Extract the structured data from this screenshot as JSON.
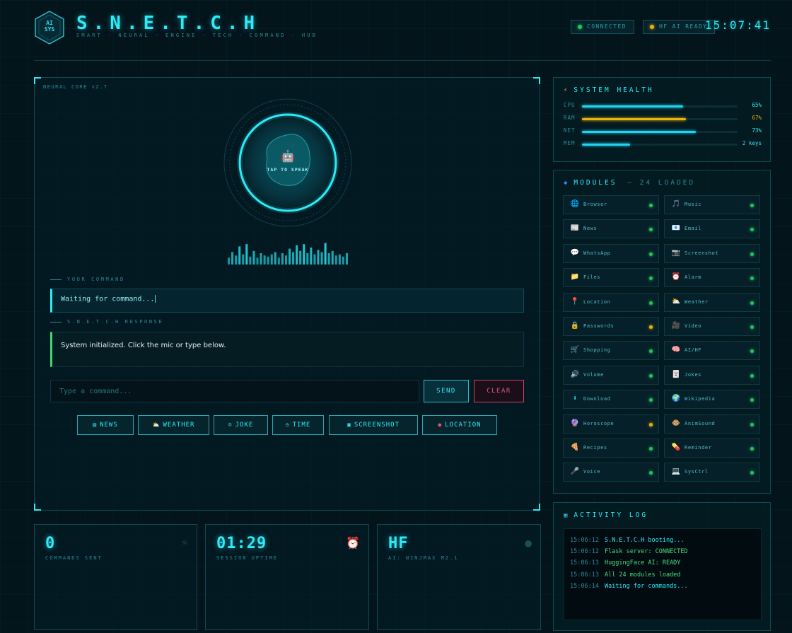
{
  "header": {
    "logo_line1": "AI",
    "logo_line2": "SYS",
    "title": "S.N.E.T.C.H",
    "subtitle": "SMART · NEURAL · ENGINE · TECH · COMMAND · HUB",
    "status_connected": "CONNECTED",
    "status_ai": "HF AI READY",
    "clock": "15:07:41",
    "colors": {
      "connected_dot": "#22c55e",
      "ai_dot": "#eab308"
    }
  },
  "main": {
    "core_tag": "NEURAL CORE v2.7",
    "tap_label": "TAP TO SPEAK",
    "mic_icon": "robot-mic-icon",
    "command_label": "YOUR COMMAND",
    "command_text": "Waiting for command...",
    "response_label": "S.N.E.T.C.H RESPONSE",
    "response_text": "System initialized. Click the mic or type below.",
    "input_placeholder": "Type a command...",
    "send_label": "SEND",
    "clear_label": "CLEAR",
    "quick_actions": [
      {
        "icon": "▤",
        "label": "NEWS"
      },
      {
        "icon": "⛅",
        "label": "WEATHER"
      },
      {
        "icon": "☺",
        "label": "JOKE"
      },
      {
        "icon": "◷",
        "label": "TIME"
      },
      {
        "icon": "▣",
        "label": "SCREENSHOT"
      },
      {
        "icon": "●",
        "label": "LOCATION"
      }
    ],
    "equalizer_levels": [
      0.3,
      0.55,
      0.4,
      0.8,
      0.45,
      0.9,
      0.35,
      0.6,
      0.3,
      0.5,
      0.4,
      0.35,
      0.45,
      0.55,
      0.3,
      0.5,
      0.4,
      0.7,
      0.55,
      0.85,
      0.6,
      0.9,
      0.5,
      0.75,
      0.45,
      0.65,
      0.55,
      0.95,
      0.5,
      0.6,
      0.4,
      0.45,
      0.35,
      0.5
    ]
  },
  "stats": [
    {
      "value": "0",
      "label": "COMMANDS SENT",
      "icon": "☼"
    },
    {
      "value": "01:29",
      "label": "SESSION UPTIME",
      "icon": "⏰"
    },
    {
      "value": "HF",
      "label": "AI: NINJMAX M2.1",
      "icon": "●"
    }
  ],
  "health": {
    "title": "SYSTEM HEALTH",
    "icon": "⚡",
    "metrics": [
      {
        "label": "CPU",
        "value": "65%",
        "fill": 0.65,
        "color": "#22d3ee"
      },
      {
        "label": "RAM",
        "value": "67%",
        "fill": 0.67,
        "color": "#eab308"
      },
      {
        "label": "NET",
        "value": "73%",
        "fill": 0.73,
        "color": "#22d3ee"
      },
      {
        "label": "MEM",
        "value": "2 keys",
        "fill": 0.31,
        "color": "#22d3ee"
      }
    ]
  },
  "modules": {
    "title": "MODULES",
    "count_label": "— 24 LOADED",
    "icon": "◆",
    "items": [
      {
        "icon": "🌐",
        "label": "Browser",
        "status": "#22c55e"
      },
      {
        "icon": "🎵",
        "label": "Music",
        "status": "#22c55e"
      },
      {
        "icon": "📰",
        "label": "News",
        "status": "#22c55e"
      },
      {
        "icon": "📧",
        "label": "Email",
        "status": "#22c55e"
      },
      {
        "icon": "💬",
        "label": "WhatsApp",
        "status": "#22c55e"
      },
      {
        "icon": "📷",
        "label": "Screenshot",
        "status": "#22c55e"
      },
      {
        "icon": "📁",
        "label": "Files",
        "status": "#22c55e"
      },
      {
        "icon": "⏰",
        "label": "Alarm",
        "status": "#22c55e"
      },
      {
        "icon": "📍",
        "label": "Location",
        "status": "#22c55e"
      },
      {
        "icon": "⛅",
        "label": "Weather",
        "status": "#22c55e"
      },
      {
        "icon": "🔒",
        "label": "Passwords",
        "status": "#eab308"
      },
      {
        "icon": "🎥",
        "label": "Video",
        "status": "#22c55e"
      },
      {
        "icon": "🛒",
        "label": "Shopping",
        "status": "#22c55e"
      },
      {
        "icon": "🧠",
        "label": "AI/HF",
        "status": "#22c55e"
      },
      {
        "icon": "🔊",
        "label": "Volume",
        "status": "#22c55e"
      },
      {
        "icon": "🃏",
        "label": "Jokes",
        "status": "#22c55e"
      },
      {
        "icon": "⬇",
        "label": "Download",
        "status": "#22c55e"
      },
      {
        "icon": "🌍",
        "label": "Wikipedia",
        "status": "#22c55e"
      },
      {
        "icon": "🔮",
        "label": "Horoscope",
        "status": "#eab308"
      },
      {
        "icon": "🐵",
        "label": "AnimSound",
        "status": "#22c55e"
      },
      {
        "icon": "🍕",
        "label": "Recipes",
        "status": "#22c55e"
      },
      {
        "icon": "💊",
        "label": "Reminder",
        "status": "#22c55e"
      },
      {
        "icon": "🎤",
        "label": "Voice",
        "status": "#22c55e"
      },
      {
        "icon": "💻",
        "label": "SysCtrl",
        "status": "#22c55e"
      }
    ]
  },
  "activity": {
    "title": "ACTIVITY LOG",
    "icon": "▣",
    "entries": [
      {
        "time": "15:06:12",
        "text": "S.N.E.T.C.H booting...",
        "color": "#2cecf8"
      },
      {
        "time": "15:06:12",
        "text": "Flask server: CONNECTED",
        "color": "#4ade80"
      },
      {
        "time": "15:06:13",
        "text": "HuggingFace AI: READY",
        "color": "#4ade80"
      },
      {
        "time": "15:06:13",
        "text": "All 24 modules loaded",
        "color": "#4ade80"
      },
      {
        "time": "15:06:14",
        "text": "Waiting for commands...",
        "color": "#2cecf8"
      }
    ]
  }
}
